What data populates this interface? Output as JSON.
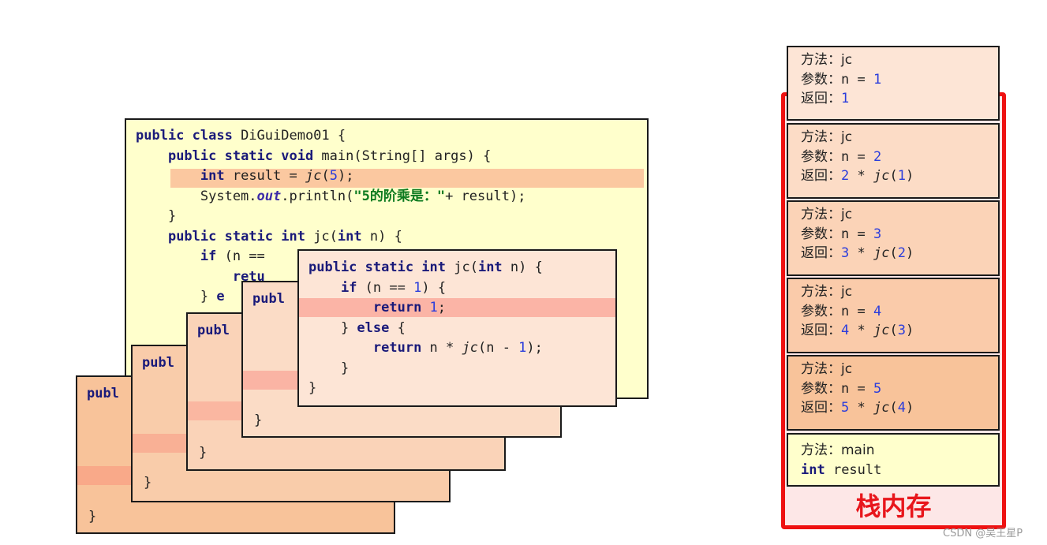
{
  "main_class": {
    "lines": [
      {
        "segs": [
          {
            "t": "public class ",
            "c": "kw"
          },
          {
            "t": "DiGuiDemo01 {"
          }
        ]
      },
      {
        "segs": [
          {
            "t": "    "
          },
          {
            "t": "public static void ",
            "c": "kw"
          },
          {
            "t": "main(String[] args) {"
          }
        ]
      },
      {
        "segs": [
          {
            "t": "        "
          },
          {
            "t": "int ",
            "c": "kw"
          },
          {
            "t": "result = "
          },
          {
            "t": "jc",
            "c": "it"
          },
          {
            "t": "("
          },
          {
            "t": "5",
            "c": "num"
          },
          {
            "t": ");"
          }
        ]
      },
      {
        "segs": [
          {
            "t": "        System."
          },
          {
            "t": "out",
            "c": "outfld"
          },
          {
            "t": ".println("
          },
          {
            "t": "\"5的阶乘是：\"",
            "c": "str"
          },
          {
            "t": "+ result);"
          }
        ]
      },
      {
        "segs": [
          {
            "t": "    }"
          }
        ]
      },
      {
        "segs": [
          {
            "t": "    "
          },
          {
            "t": "public static int ",
            "c": "kw"
          },
          {
            "t": "jc("
          },
          {
            "t": "int ",
            "c": "kw"
          },
          {
            "t": "n) {"
          }
        ]
      },
      {
        "segs": [
          {
            "t": "        "
          },
          {
            "t": "if ",
            "c": "kw"
          },
          {
            "t": "(n =="
          }
        ]
      },
      {
        "segs": [
          {
            "t": "            "
          },
          {
            "t": "retu",
            "c": "kw"
          }
        ]
      },
      {
        "segs": [
          {
            "t": "        } "
          },
          {
            "t": "e",
            "c": "kw"
          }
        ]
      }
    ]
  },
  "jc_frames": [
    {
      "lines": [
        {
          "segs": [
            {
              "t": "publ",
              "c": "kw"
            }
          ]
        }
      ]
    },
    {
      "lines": [
        {
          "segs": [
            {
              "t": "publ",
              "c": "kw"
            }
          ]
        }
      ]
    },
    {
      "lines": [
        {
          "segs": [
            {
              "t": "publ",
              "c": "kw"
            }
          ]
        }
      ]
    },
    {
      "lines": [
        {
          "segs": [
            {
              "t": "publ",
              "c": "kw"
            }
          ]
        }
      ]
    },
    {
      "lines": [
        {
          "segs": [
            {
              "t": "public static int ",
              "c": "kw"
            },
            {
              "t": "jc("
            },
            {
              "t": "int ",
              "c": "kw"
            },
            {
              "t": "n) {"
            }
          ]
        },
        {
          "segs": [
            {
              "t": "    "
            },
            {
              "t": "if ",
              "c": "kw"
            },
            {
              "t": "(n == "
            },
            {
              "t": "1",
              "c": "num"
            },
            {
              "t": ") {"
            }
          ]
        },
        {
          "segs": [
            {
              "t": "        "
            },
            {
              "t": "return ",
              "c": "kw"
            },
            {
              "t": "1",
              "c": "num"
            },
            {
              "t": ";"
            }
          ]
        },
        {
          "segs": [
            {
              "t": "    } "
            },
            {
              "t": "else ",
              "c": "kw"
            },
            {
              "t": "{"
            }
          ]
        },
        {
          "segs": [
            {
              "t": "        "
            },
            {
              "t": "return ",
              "c": "kw"
            },
            {
              "t": "n * "
            },
            {
              "t": "jc",
              "c": "it"
            },
            {
              "t": "(n - "
            },
            {
              "t": "1",
              "c": "num"
            },
            {
              "t": ");"
            }
          ]
        },
        {
          "segs": [
            {
              "t": "    }"
            }
          ]
        },
        {
          "segs": [
            {
              "t": "}"
            }
          ]
        }
      ]
    }
  ],
  "closing_braces": [
    "}",
    "}",
    "}",
    "}"
  ],
  "stack": {
    "frames": [
      {
        "method": "方法：jc",
        "param_label": "参数：",
        "param": "n = ",
        "param_val": "1",
        "ret_label": "返回：",
        "ret": [
          {
            "t": "1",
            "c": "blue"
          }
        ]
      },
      {
        "method": "方法：jc",
        "param_label": "参数：",
        "param": "n = ",
        "param_val": "2",
        "ret_label": "返回：",
        "ret": [
          {
            "t": "2",
            "c": "blue"
          },
          {
            "t": " * "
          },
          {
            "t": "jc",
            "c": "it"
          },
          {
            "t": "("
          },
          {
            "t": "1",
            "c": "blue"
          },
          {
            "t": ")"
          }
        ]
      },
      {
        "method": "方法：jc",
        "param_label": "参数：",
        "param": "n = ",
        "param_val": "3",
        "ret_label": "返回：",
        "ret": [
          {
            "t": "3",
            "c": "blue"
          },
          {
            "t": " * "
          },
          {
            "t": "jc",
            "c": "it"
          },
          {
            "t": "("
          },
          {
            "t": "2",
            "c": "blue"
          },
          {
            "t": ")"
          }
        ]
      },
      {
        "method": "方法：jc",
        "param_label": "参数：",
        "param": "n = ",
        "param_val": "4",
        "ret_label": "返回：",
        "ret": [
          {
            "t": "4",
            "c": "blue"
          },
          {
            "t": " * "
          },
          {
            "t": "jc",
            "c": "it"
          },
          {
            "t": "("
          },
          {
            "t": "3",
            "c": "blue"
          },
          {
            "t": ")"
          }
        ]
      },
      {
        "method": "方法：jc",
        "param_label": "参数：",
        "param": "n = ",
        "param_val": "5",
        "ret_label": "返回：",
        "ret": [
          {
            "t": "5",
            "c": "blue"
          },
          {
            "t": " * "
          },
          {
            "t": "jc",
            "c": "it"
          },
          {
            "t": "("
          },
          {
            "t": "4",
            "c": "blue"
          },
          {
            "t": ")"
          }
        ]
      }
    ],
    "main_frame": {
      "method": "方法：main",
      "var_kw": "int",
      "var": " result"
    },
    "label": "栈内存"
  },
  "watermark": "CSDN @吴王星P",
  "colors": {
    "main_bg": "#ffffcc",
    "main_highlight": "#fbc8a0",
    "frame_bg_light": "#fde5d6",
    "frame_bg_dark": "#f8c39a",
    "frame_highlight": "#fbb4a6",
    "stack_label": "#e8161c",
    "number": "#2a3cdc"
  }
}
